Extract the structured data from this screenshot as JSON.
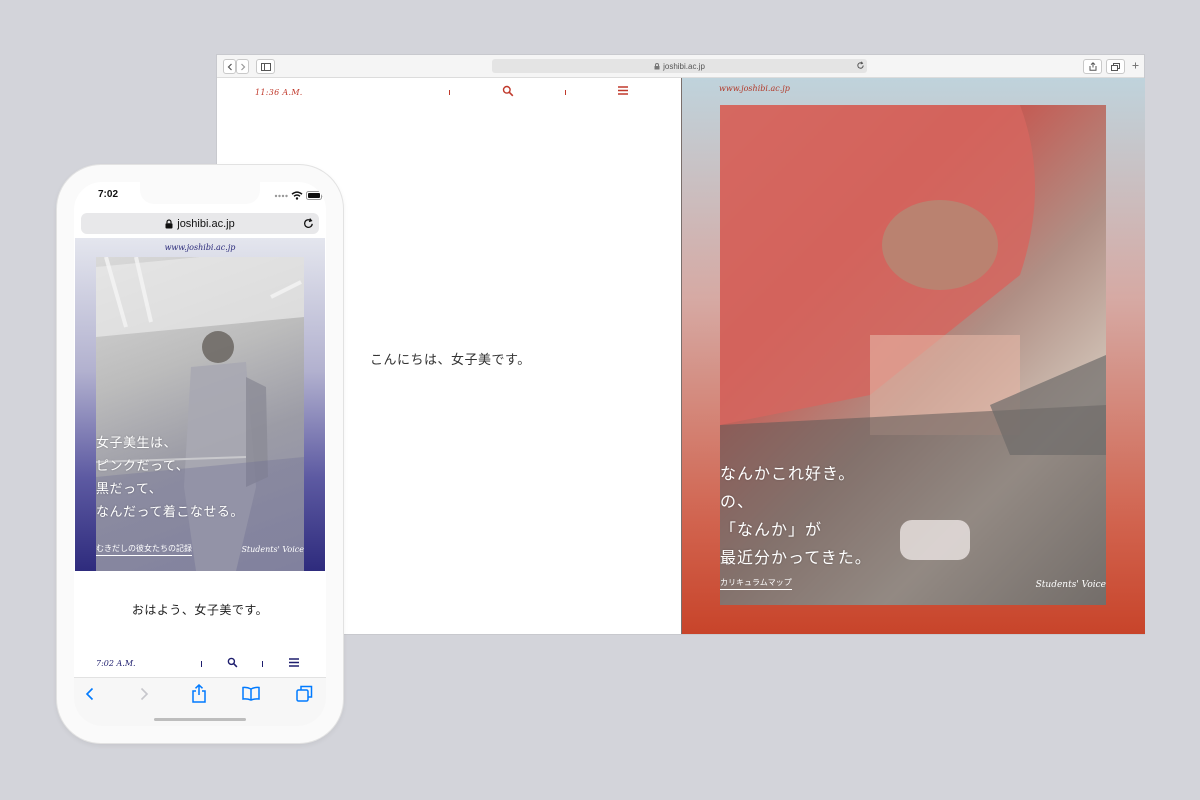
{
  "desktop": {
    "url": "joshibi.ac.jp",
    "left_panel": {
      "time": "11:36 A.M.",
      "greeting": "こんにちは、女子美です。"
    },
    "right_panel": {
      "domain": "www.joshibi.ac.jp",
      "headline": [
        "なんかこれ好き。",
        "の、",
        "「なんか」が",
        "最近分かってきた。"
      ],
      "link": "カリキュラムマップ",
      "signature": "Students' Voice"
    },
    "colors": {
      "accent": "#c0392b",
      "gradient_top": "#bfd3dc",
      "gradient_bottom": "#c8442a"
    }
  },
  "mobile": {
    "status": {
      "time": "7:02"
    },
    "url": "joshibi.ac.jp",
    "domain": "www.joshibi.ac.jp",
    "headline": [
      "女子美生は、",
      "ピンクだって、",
      "黒だって、",
      "なんだって着こなせる。"
    ],
    "link": "むきだしの彼女たちの記録",
    "signature": "Students' Voice",
    "greeting": "おはよう、女子美です。",
    "nav_time": "7:02 A.M.",
    "colors": {
      "accent": "#1e1e6e",
      "gradient_bottom": "#2e2b7d",
      "ios_blue": "#007aff"
    }
  }
}
